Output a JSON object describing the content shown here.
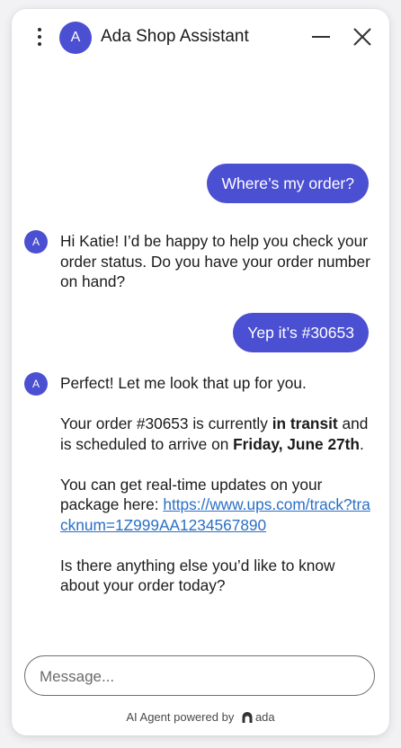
{
  "header": {
    "avatar_letter": "A",
    "title": "Ada Shop Assistant"
  },
  "colors": {
    "accent": "#4b4fd1",
    "link": "#2a6fc5"
  },
  "messages": [
    {
      "from": "user",
      "text": "Where’s my order?"
    },
    {
      "from": "bot",
      "avatar_letter": "A",
      "text": "Hi Katie! I’d be happy to help you check your order status. Do you have your order number on hand?"
    },
    {
      "from": "user",
      "text": "Yep it’s #30653"
    },
    {
      "from": "bot",
      "avatar_letter": "A",
      "p1": "Perfect! Let me look that up for you.",
      "p2_a": "Your order #30653 is currently ",
      "p2_b": "in transit",
      "p2_c": " and is scheduled to arrive on ",
      "p2_d": "Friday, June 27th",
      "p2_e": ".",
      "p3_a": "You can get real-time updates on your package here: ",
      "p3_link": "https://www.ups.com/track?tracknum=1Z999AA1234567890",
      "p4": "Is there anything else you’d like to know about your order today?"
    }
  ],
  "input": {
    "placeholder": "Message..."
  },
  "footer": {
    "text": "AI Agent powered by",
    "brand": "ada"
  },
  "icons": {
    "menu": "kebab-menu-icon",
    "minimize": "minimize-icon",
    "close": "close-icon",
    "brand": "ada-logo-icon"
  }
}
